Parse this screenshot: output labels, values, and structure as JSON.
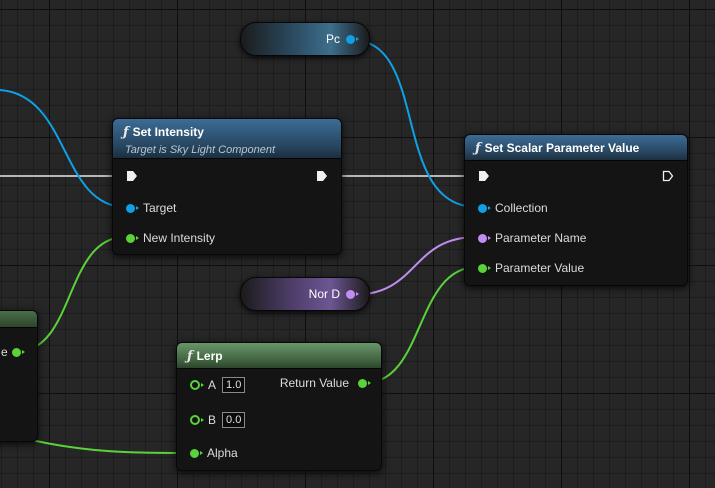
{
  "colors": {
    "object_wire": "#0fa0e6",
    "float_wire": "#5ad23a",
    "name_wire": "#c28df2",
    "exec_wire": "#e8e8e8",
    "function_header": "#3c6c96",
    "pure_header": "#6a9669"
  },
  "variables": {
    "pc": {
      "label": "Pc"
    },
    "nord": {
      "label": "Nor D"
    }
  },
  "set_intensity": {
    "title": "Set Intensity",
    "subtitle": "Target is Sky Light Component",
    "pins": {
      "target": "Target",
      "new_intensity": "New Intensity"
    }
  },
  "set_scalar": {
    "title": "Set Scalar Parameter Value",
    "pins": {
      "collection": "Collection",
      "parameter_name": "Parameter Name",
      "parameter_value": "Parameter Value"
    }
  },
  "lerp": {
    "title": "Lerp",
    "pins": {
      "a": "A",
      "a_value": "1.0",
      "b": "B",
      "b_value": "0.0",
      "alpha": "Alpha",
      "return_value": "Return Value"
    }
  },
  "partial_node": {
    "pin_label_fragment": "e"
  }
}
